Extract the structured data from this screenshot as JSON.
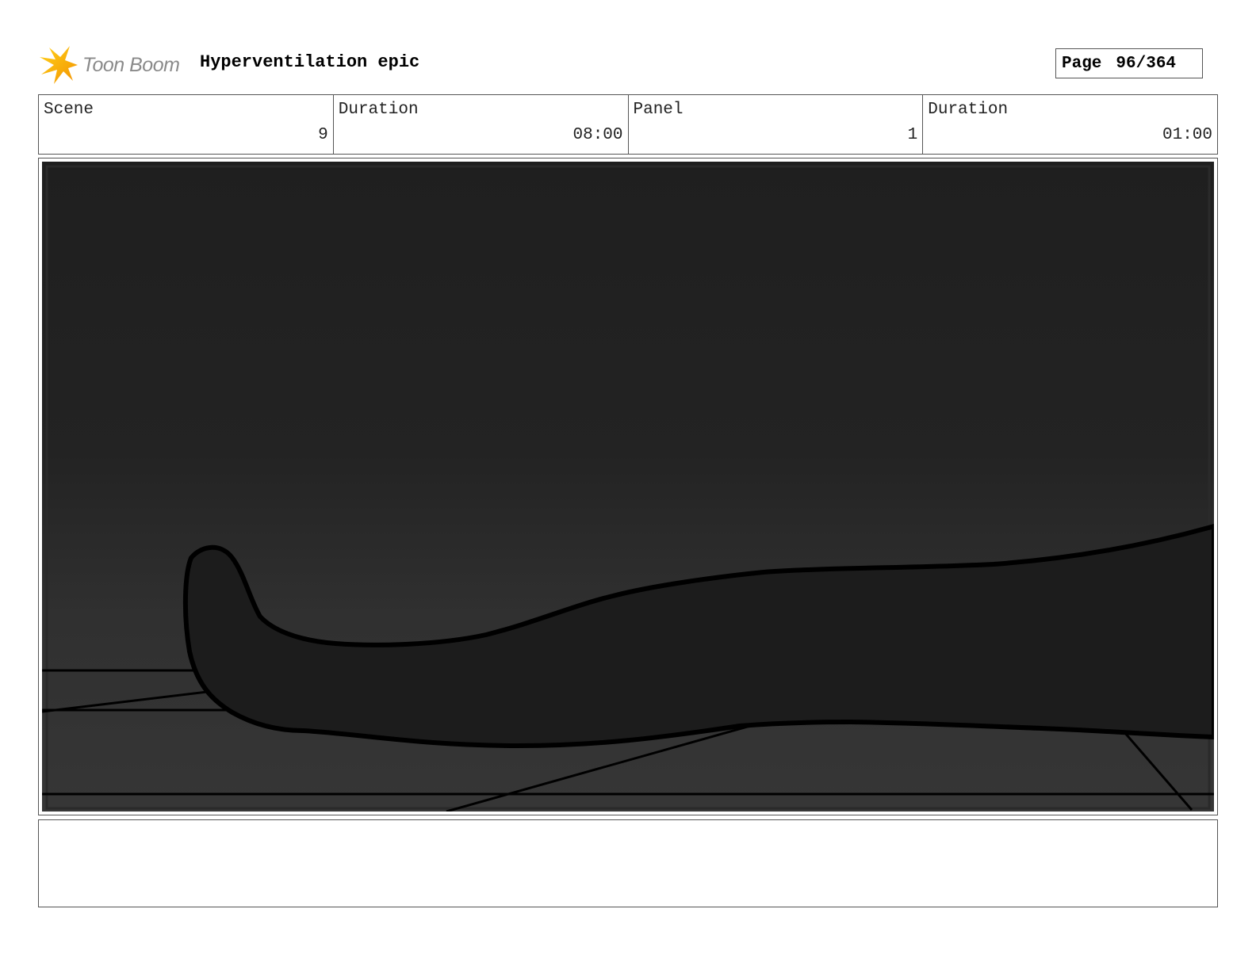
{
  "header": {
    "logo_text": "Toon Boom",
    "project_title": "Hyperventilation epic",
    "page_label": "Page",
    "page_number": "96/364"
  },
  "info": {
    "scene_label": "Scene",
    "scene_value": "9",
    "scene_duration_label": "Duration",
    "scene_duration_value": "08:00",
    "panel_label": "Panel",
    "panel_value": "1",
    "panel_duration_label": "Duration",
    "panel_duration_value": "01:00"
  },
  "notes": {
    "text": ""
  },
  "colors": {
    "logo_yellow": "#f5c400",
    "logo_orange": "#f39200",
    "panel_dark": "#1f1f1f",
    "panel_light": "#363636",
    "shape_fill": "#1c1c1c",
    "ink": "#000000"
  }
}
